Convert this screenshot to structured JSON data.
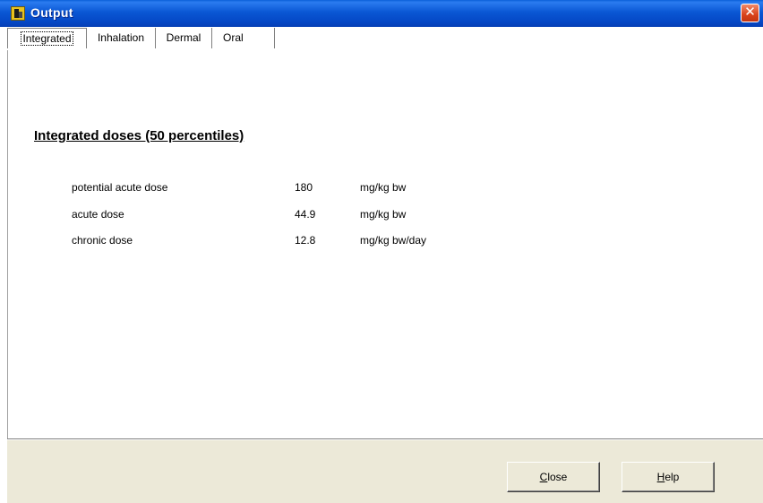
{
  "window": {
    "title": "Output",
    "close_symbol": "✕",
    "icon": "app-icon"
  },
  "tabs": [
    {
      "label": "Integrated",
      "active": true
    },
    {
      "label": "Inhalation",
      "active": false
    },
    {
      "label": "Dermal",
      "active": false
    },
    {
      "label": "Oral",
      "active": false
    }
  ],
  "main": {
    "heading": "Integrated doses (50 percentiles)",
    "rows": [
      {
        "label": "potential acute dose",
        "value": "180",
        "unit": "mg/kg bw"
      },
      {
        "label": "acute dose",
        "value": "44.9",
        "unit": "mg/kg bw"
      },
      {
        "label": "chronic dose",
        "value": "12.8",
        "unit": "mg/kg bw/day"
      }
    ]
  },
  "buttons": {
    "close": {
      "mnemonic": "C",
      "rest": "lose"
    },
    "help": {
      "mnemonic": "H",
      "rest": "elp"
    }
  },
  "colors": {
    "titlebar": "#0a57d4",
    "close_button": "#d9431c",
    "button_bar": "#ece9d8"
  }
}
